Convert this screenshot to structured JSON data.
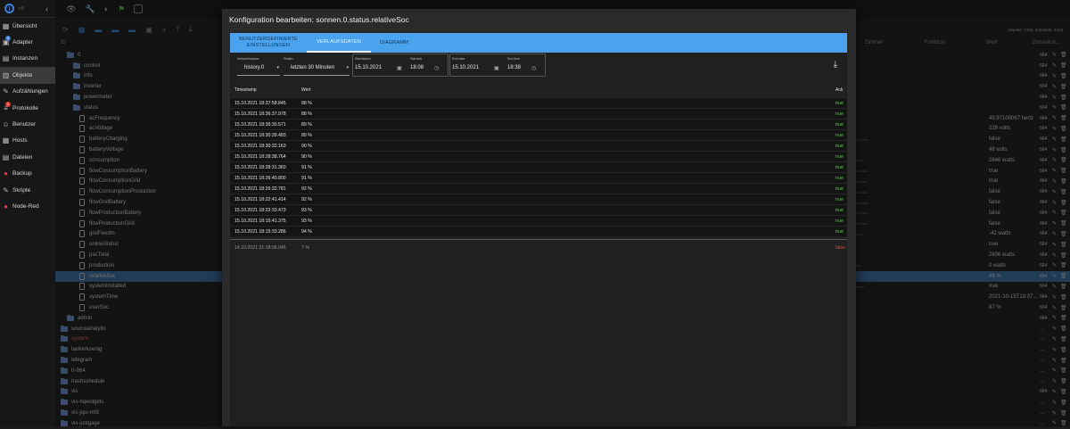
{
  "sidebar": {
    "items": [
      {
        "label": "Übersicht",
        "icon": "grid-icon"
      },
      {
        "label": "Adapter",
        "icon": "adapter-icon",
        "badge": "5"
      },
      {
        "label": "Instanzen",
        "icon": "instances-icon"
      },
      {
        "label": "Objekte",
        "icon": "objects-icon",
        "active": true
      },
      {
        "label": "Aufzählungen",
        "icon": "enum-icon"
      },
      {
        "label": "Protokolle",
        "icon": "log-icon",
        "badge": "1"
      },
      {
        "label": "Benutzer",
        "icon": "user-icon"
      },
      {
        "label": "Hosts",
        "icon": "hosts-icon"
      },
      {
        "label": "Dateien",
        "icon": "files-icon"
      },
      {
        "label": "Backup",
        "icon": "backup-icon"
      },
      {
        "label": "Skripte",
        "icon": "scripts-icon"
      },
      {
        "label": "Node-Red",
        "icon": "nodered-icon"
      }
    ]
  },
  "objects": {
    "stats": "Objekte: 7304, Zustände: 6433",
    "columns": {
      "id": "ID",
      "room": "Zimmer",
      "function": "Funktion",
      "value": "Wert",
      "settings": "Einstellun..."
    },
    "tree": [
      {
        "label": "0",
        "type": "folder",
        "indent": 1,
        "num": "664"
      },
      {
        "label": "control",
        "type": "folder",
        "indent": 2,
        "num": "664"
      },
      {
        "label": "info",
        "type": "folder",
        "indent": 2,
        "num": "664"
      },
      {
        "label": "inverter",
        "type": "folder",
        "indent": 2,
        "num": "664"
      },
      {
        "label": "powermeter",
        "type": "folder",
        "indent": 2,
        "num": "664"
      },
      {
        "label": "status",
        "type": "folder",
        "indent": 2,
        "num": "664"
      },
      {
        "label": "acFrequency",
        "type": "file",
        "indent": 3,
        "value": "49,97100067 hertz",
        "num": "664"
      },
      {
        "label": "acVoltage",
        "type": "file",
        "indent": 3,
        "value": "228 volts",
        "num": "664"
      },
      {
        "label": "batteryCharging",
        "type": "file",
        "indent": 3,
        "value": "false",
        "num": "664",
        "side": "eryCha..."
      },
      {
        "label": "batteryVoltage",
        "type": "file",
        "indent": 3,
        "value": "48 volts",
        "num": "664"
      },
      {
        "label": "consumption",
        "type": "file",
        "indent": 3,
        "value": "2646 watts",
        "num": "664",
        "side": "otion"
      },
      {
        "label": "flowConsumptionBattery",
        "type": "file",
        "indent": 3,
        "value": "true",
        "num": "664",
        "side": "Consu..."
      },
      {
        "label": "flowConsumptionGrid",
        "type": "file",
        "indent": 3,
        "value": "true",
        "num": "664",
        "side": "Consu..."
      },
      {
        "label": "flowConsumptionProduction",
        "type": "file",
        "indent": 3,
        "value": "false",
        "num": "664",
        "side": "Consu..."
      },
      {
        "label": "flowGridBattery",
        "type": "file",
        "indent": 3,
        "value": "false",
        "num": "664",
        "side": "GridBat..."
      },
      {
        "label": "flowProductionBattery",
        "type": "file",
        "indent": 3,
        "value": "false",
        "num": "664",
        "side": "Produc..."
      },
      {
        "label": "flowProductionGrid",
        "type": "file",
        "indent": 3,
        "value": "false",
        "num": "664",
        "side": "Produc..."
      },
      {
        "label": "gridFeedIn",
        "type": "file",
        "indent": 3,
        "value": "-42 watts",
        "num": "664",
        "side": "edIn"
      },
      {
        "label": "onlineStatus",
        "type": "file",
        "indent": 3,
        "value": "true",
        "num": "664"
      },
      {
        "label": "pacTotal",
        "type": "file",
        "indent": 3,
        "value": "2606 watts",
        "num": "664"
      },
      {
        "label": "production",
        "type": "file",
        "indent": 3,
        "value": "0 watts",
        "num": "664",
        "side": "tion"
      },
      {
        "label": "relativeSoc",
        "type": "file",
        "indent": 3,
        "value": "88 %",
        "num": "664",
        "selected": true
      },
      {
        "label": "systemInstalled",
        "type": "file",
        "indent": 3,
        "value": "true",
        "num": "664",
        "side": "stalle..."
      },
      {
        "label": "systemTime",
        "type": "file",
        "indent": 3,
        "value": "2021-10-15T18:37...",
        "num": "664"
      },
      {
        "label": "userSoc",
        "type": "file",
        "indent": 3,
        "value": "87 %",
        "num": "664"
      },
      {
        "label": "admin",
        "type": "folder",
        "indent": 1,
        "num": "664"
      },
      {
        "label": "sourceanalytix",
        "type": "folder",
        "indent": 0,
        "num": "..."
      },
      {
        "label": "system",
        "type": "folder",
        "indent": 0,
        "num": "...",
        "red": true
      },
      {
        "label": "tankerkoenig",
        "type": "folder",
        "indent": 0,
        "num": "..."
      },
      {
        "label": "telegram",
        "type": "folder",
        "indent": 0,
        "num": "..."
      },
      {
        "label": "tr-064",
        "type": "folder",
        "indent": 0,
        "num": "..."
      },
      {
        "label": "trashschedule",
        "type": "folder",
        "indent": 0,
        "num": "..."
      },
      {
        "label": "vis",
        "type": "folder",
        "indent": 0,
        "num": "664"
      },
      {
        "label": "vis-hqwidgets",
        "type": "folder",
        "indent": 0,
        "num": "..."
      },
      {
        "label": "vis-jqui-mfd",
        "type": "folder",
        "indent": 0,
        "num": "..."
      },
      {
        "label": "vis-justgage",
        "type": "folder",
        "indent": 0,
        "num": "..."
      }
    ]
  },
  "dialog": {
    "title": "Konfiguration bearbeiten: sonnen.0.status.relativeSoc",
    "tabs": [
      {
        "label": "BENUTZERDEFINIERTE EINSTELLUNGEN"
      },
      {
        "label": "VERLAUFSDATEN",
        "active": true
      },
      {
        "label": "DIAGRAMM"
      }
    ],
    "controls": {
      "instance_label": "Verlaufsinstanz",
      "instance_value": "history.0",
      "relative_label": "Relativ",
      "relative_value": "letzten 30 Minuten",
      "start_date_label": "Startdatum",
      "start_date_value": "15.10.2021",
      "start_time_label": "Startzeit",
      "start_time_value": "18:08",
      "end_date_label": "End date",
      "end_date_value": "15.10.2021",
      "end_time_label": "End time",
      "end_time_value": "18:38"
    },
    "table": {
      "headers": {
        "ts": "Timestamp",
        "val": "Wert",
        "ack": "Ack"
      },
      "rows": [
        {
          "ts": "15.10.2021 18:37:58.845",
          "val": "88 %",
          "ack": "true"
        },
        {
          "ts": "15.10.2021 18:36:37.978",
          "val": "88 %",
          "ack": "true"
        },
        {
          "ts": "15.10.2021 18:36:30.571",
          "val": "89 %",
          "ack": "true"
        },
        {
          "ts": "15.10.2021 18:30:39.483",
          "val": "89 %",
          "ack": "true"
        },
        {
          "ts": "15.10.2021 18:30:32.163",
          "val": "90 %",
          "ack": "true"
        },
        {
          "ts": "15.10.2021 18:28:38.764",
          "val": "90 %",
          "ack": "true"
        },
        {
          "ts": "15.10.2021 18:28:31.360",
          "val": "91 %",
          "ack": "true"
        },
        {
          "ts": "15.10.2021 18:26:40.800",
          "val": "91 %",
          "ack": "true"
        },
        {
          "ts": "15.10.2021 18:26:32.781",
          "val": "92 %",
          "ack": "true"
        },
        {
          "ts": "15.10.2021 18:22:41.414",
          "val": "92 %",
          "ack": "true"
        },
        {
          "ts": "15.10.2021 18:22:33.473",
          "val": "93 %",
          "ack": "true"
        },
        {
          "ts": "15.10.2021 18:15:41.375",
          "val": "93 %",
          "ack": "true"
        },
        {
          "ts": "15.10.2021 18:15:33.286",
          "val": "94 %",
          "ack": "true"
        }
      ],
      "extra_row": {
        "ts": "14.10.2021 21:18:06.046",
        "val": "7 %",
        "ack": "false"
      }
    }
  },
  "colors": {
    "accent": "#4aa3ec",
    "selected": "#3c6e9f",
    "ack_true": "#58c35a",
    "ack_false": "#d05050"
  }
}
